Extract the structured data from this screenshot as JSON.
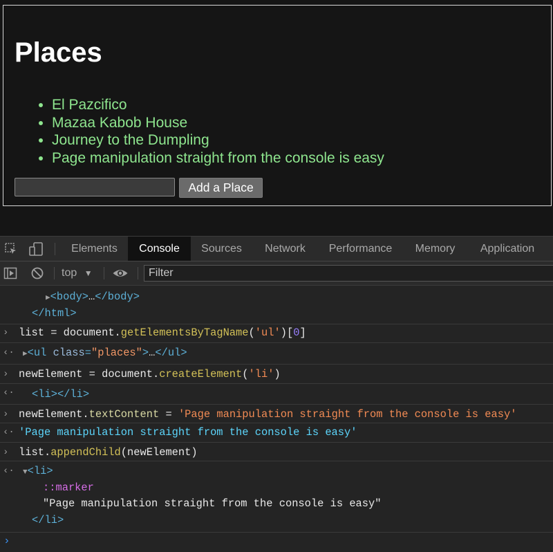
{
  "page": {
    "title": "Places",
    "places": [
      "El Pazcifico",
      "Mazaa Kabob House",
      "Journey to the Dumpling",
      "Page manipulation straight from the console is easy"
    ],
    "input_value": "",
    "add_button_label": "Add a Place"
  },
  "devtools": {
    "tabs": [
      "Elements",
      "Console",
      "Sources",
      "Network",
      "Performance",
      "Memory",
      "Application"
    ],
    "active_tab": "Console",
    "context": "top",
    "filter_placeholder": "Filter",
    "icons": [
      "inspect-icon",
      "device-toggle-icon",
      "sidebar-toggle-icon",
      "clear-console-icon",
      "dropdown-arrow-icon",
      "eye-icon"
    ]
  },
  "console": {
    "history": {
      "body_open": "<body>",
      "ellipsis": "…",
      "body_close": "</body>",
      "html_close": "</html>"
    },
    "cmd1": {
      "var": "list",
      "eq": " = ",
      "obj": "document.",
      "method": "getElementsByTagName",
      "paren_open": "(",
      "arg": "'ul'",
      "paren_close": ")[",
      "index": "0",
      "bracket_close": "]"
    },
    "res1": {
      "tag_open": "<ul",
      "attr": " class",
      "eq": "=",
      "attr_value": "\"places\"",
      "tag_end": ">",
      "ellipsis": "…",
      "tag_close": "</ul>"
    },
    "cmd2": {
      "var": "newElement",
      "eq": " = ",
      "obj": "document.",
      "method": "createElement",
      "paren_open": "(",
      "arg": "'li'",
      "paren_close": ")"
    },
    "res2": {
      "value": "<li></li>"
    },
    "cmd3": {
      "var": "newElement.",
      "prop": "textContent",
      "eq": " = ",
      "arg": "'Page manipulation straight from the console is easy'"
    },
    "res3": {
      "value": "'Page manipulation straight from the console is easy'"
    },
    "cmd4": {
      "var": "list.",
      "method": "appendChild",
      "arg": "(newElement)"
    },
    "res4": {
      "open": "<li>",
      "marker": "::marker",
      "text": "\"Page manipulation straight from the console is easy\"",
      "close": "</li>"
    },
    "prompt_symbol": "›"
  },
  "colors": {
    "page_bg": "#151515",
    "list_text": "#8ee58e",
    "devtools_bg": "#242424",
    "tag": "#5db0d7",
    "string": "#f28b54",
    "string_result": "#5cd5fb",
    "pseudo": "#d56de5",
    "prompt": "#3b8eea"
  }
}
